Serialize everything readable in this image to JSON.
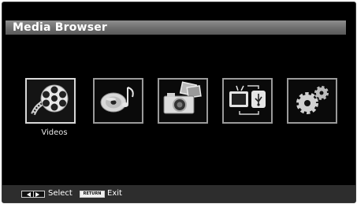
{
  "header": {
    "title": "Media Browser"
  },
  "tiles": [
    {
      "icon": "video-reel-icon",
      "label": "Videos",
      "selected": true
    },
    {
      "icon": "music-disc-icon",
      "label": "",
      "selected": false
    },
    {
      "icon": "photo-camera-icon",
      "label": "",
      "selected": false
    },
    {
      "icon": "tv-usb-icon",
      "label": "",
      "selected": false
    },
    {
      "icon": "settings-gears-icon",
      "label": "",
      "selected": false
    }
  ],
  "footer": {
    "select_key": "arrow-left-right-icon",
    "select_label": "Select",
    "exit_key": "RETURN",
    "exit_label": "Exit"
  },
  "colors": {
    "background": "#000000",
    "title_bar": "#767676",
    "footer_bar": "#2d2d2d",
    "tile_border": "#9a9a9a",
    "text": "#ffffff"
  }
}
